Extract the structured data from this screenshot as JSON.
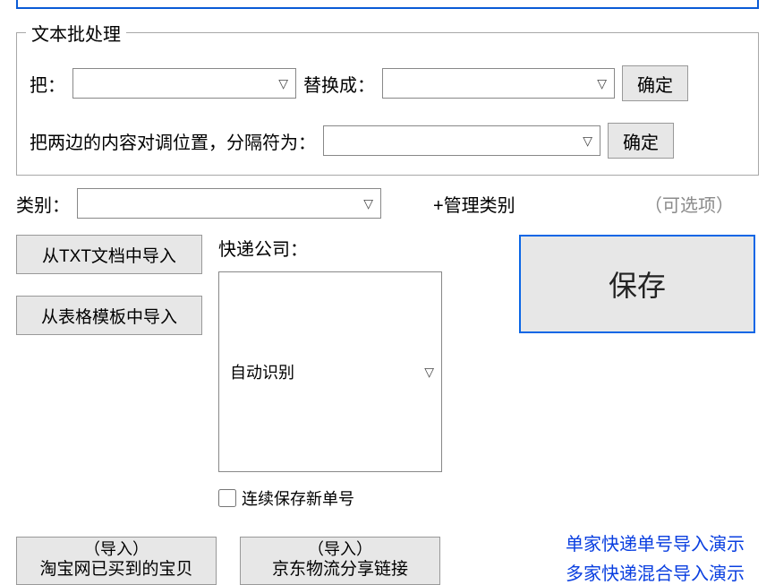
{
  "batch": {
    "group_title": "文本批处理",
    "replace_from_label": "把：",
    "replace_to_label": "替换成：",
    "confirm1": "确定",
    "swap_label": "把两边的内容对调位置，分隔符为：",
    "confirm2": "确定"
  },
  "category": {
    "label": "类别：",
    "manage": "+管理类别",
    "optional": "（可选项）"
  },
  "import": {
    "from_txt": "从TXT文档中导入",
    "from_template": "从表格模板中导入"
  },
  "courier": {
    "label": "快递公司：",
    "selected": "自动识别",
    "continuous_save": "连续保存新单号"
  },
  "save_button": "保存",
  "bottom": {
    "taobao_line1": "（导入）",
    "taobao_line2": "淘宝网已买到的宝贝",
    "jd_line1": "（导入）",
    "jd_line2": "京东物流分享链接"
  },
  "links": {
    "single": "单家快递单号导入演示",
    "multi": "多家快递混合导入演示"
  }
}
